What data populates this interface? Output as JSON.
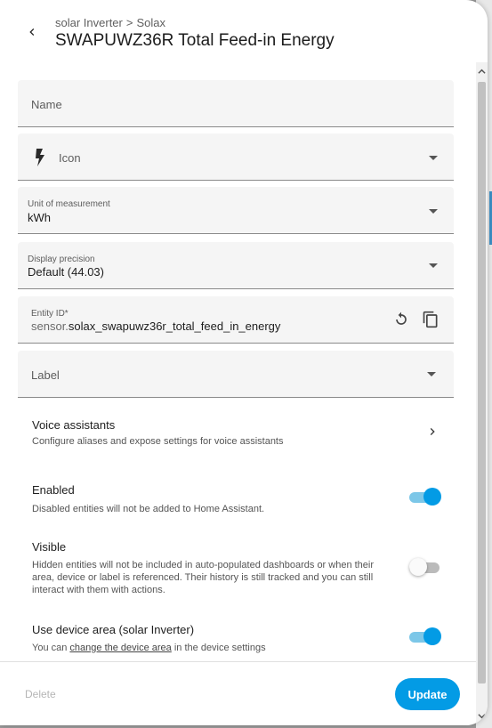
{
  "header": {
    "breadcrumb": [
      "solar Inverter",
      "Solax"
    ],
    "breadcrumb_separator": ">",
    "title": "SWAPUWZ36R Total Feed-in Energy"
  },
  "form": {
    "name": {
      "label": "Name",
      "value": ""
    },
    "icon": {
      "label": "Icon",
      "icon": "flash-icon"
    },
    "unit": {
      "label": "Unit of measurement",
      "value": "kWh"
    },
    "precision": {
      "label": "Display precision",
      "value": "Default (44.03)"
    },
    "entity_id": {
      "label": "Entity ID*",
      "prefix": "sensor.",
      "value": "solax_swapuwz36r_total_feed_in_energy"
    },
    "label": {
      "label": "Label"
    }
  },
  "voice": {
    "title": "Voice assistants",
    "description": "Configure aliases and expose settings for voice assistants"
  },
  "enabled": {
    "title": "Enabled",
    "description": "Disabled entities will not be added to Home Assistant.",
    "value": true
  },
  "visible": {
    "title": "Visible",
    "description_lines": [
      "Hidden entities will not be included in auto-populated dashboards or when their",
      "area, device or label is referenced. Their history is still tracked and you can still",
      "interact with them with actions."
    ],
    "value": false
  },
  "device_area": {
    "title": "Use device area (solar Inverter)",
    "description_prefix": "You can",
    "description_link": "change the device area",
    "description_suffix": "in the device settings",
    "value": true
  },
  "footer": {
    "delete_label": "Delete",
    "update_label": "Update"
  },
  "colors": {
    "accent": "#039be5",
    "field_bg": "#f5f5f5"
  }
}
